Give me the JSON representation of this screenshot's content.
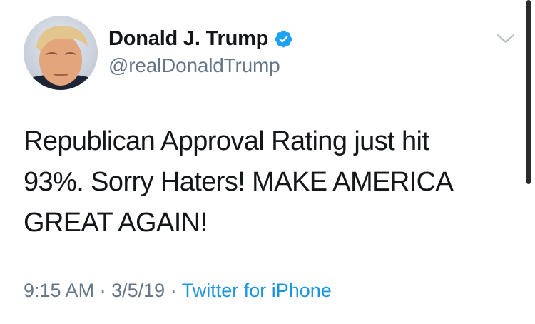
{
  "user": {
    "display_name": "Donald J. Trump",
    "handle": "@realDonaldTrump",
    "verified": true
  },
  "tweet": {
    "lines": [
      "Republican Approval Rating just hit",
      "93%. Sorry Haters! MAKE AMERICA",
      "GREAT AGAIN!"
    ],
    "time": "9:15 AM",
    "date": "3/5/19",
    "separator": "·",
    "source": "Twitter for iPhone"
  },
  "colors": {
    "text": "#14171a",
    "secondary": "#657786",
    "link": "#1b95e0",
    "verified": "#1da1f2"
  },
  "icons": {
    "verified": "verified-badge-icon",
    "menu": "chevron-down-icon"
  }
}
